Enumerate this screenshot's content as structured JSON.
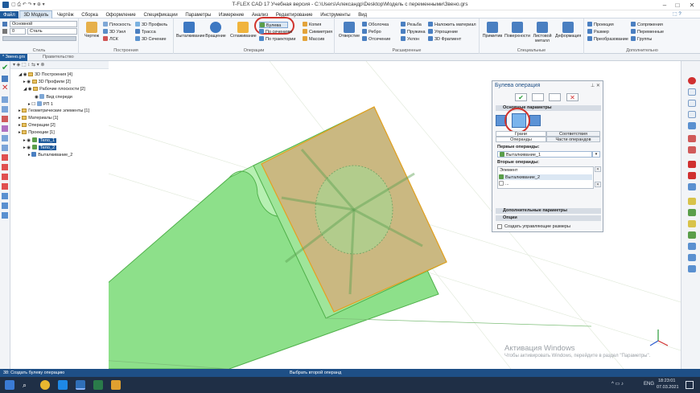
{
  "window": {
    "title": "T-FLEX CAD 17 Учебная версия - C:\\Users\\Александр\\Desktop\\Модель с переменными\\Звено.grs"
  },
  "menu": [
    "Файл",
    "3D Модель",
    "Чертёж",
    "Сборка",
    "Оформление",
    "Спецификации",
    "Параметры",
    "Измерение",
    "Анализ",
    "Редактирование",
    "Инструменты",
    "Вид"
  ],
  "ribbon": {
    "style_group": {
      "label": "Стиль",
      "layer_value": "Основной",
      "thickness_value": "0",
      "material_value": "Сталь"
    },
    "build_group": {
      "label": "Построения",
      "items": [
        "Чертеж",
        "Плоскость",
        "3D Узел",
        "ЛСК",
        "3D Профиль",
        "Трасса",
        "3D Сечение"
      ]
    },
    "ops_group": {
      "label": "Операции",
      "items": [
        "Выталкивание",
        "Вращение",
        "Сглаживание",
        "Булева",
        "По сечениям",
        "По траектории",
        "Копия",
        "Симметрия",
        "Массив"
      ]
    },
    "ext_group": {
      "label": "Расширенные",
      "items": [
        "Отверстие",
        "Оболочка",
        "Ребро",
        "Отсечение",
        "Резьба",
        "Пружина",
        "Уклон",
        "Наложить материал",
        "Упрощение",
        "3D Фрагмент"
      ]
    },
    "special_group": {
      "label": "Специальные",
      "items": [
        "Примитив",
        "Поверхности",
        "Листовой металл",
        "Деформация"
      ]
    },
    "extra_group": {
      "label": "Дополнительно",
      "items": [
        "Проекция",
        "Размер",
        "Преобразование",
        "Сопряжения",
        "Переменные",
        "Группы"
      ]
    }
  },
  "doctabs": [
    "* Звено.grs",
    "Правительство"
  ],
  "tree": [
    "3D Построения [4]",
    "3D Профили [2]",
    "Рабочие плоскости [2]",
    "Вид спереди",
    "РП 1",
    "Геометрические элементы [1]",
    "Материалы [1]",
    "Операции [2]",
    "Проекции [1]",
    "Тело_1",
    "Тело_2",
    "Выталкивание_2"
  ],
  "bool_panel": {
    "title": "Булева операция",
    "section_main": "Основные параметры",
    "tab_faces": "Грани",
    "tab_ops": "Операнды",
    "tab_match": "Соответствия",
    "tab_parts": "Части операндов",
    "first_label": "Первые операнды:",
    "first_value": "Выталкивание_1",
    "second_label": "Вторые операнды:",
    "list_header": "Элемент",
    "list_item1": "Выталкивание_2",
    "list_item2": "...",
    "section_extra": "Дополнительные параметры",
    "section_options": "Опции",
    "checkbox_label": "Создать управляющие размеры"
  },
  "status": {
    "left": "38: Создать булеву операцию",
    "center": "Выбрать второй операнд"
  },
  "watermark": {
    "line1": "Активация Windows",
    "line2": "Чтобы активировать Windows, перейдите в раздел \"Параметры\"."
  },
  "taskbar": {
    "lang": "ENG",
    "time": "18:23:01",
    "date": "07.03.2021"
  },
  "colors": {
    "accent": "#1e5a9b",
    "highlight_circle": "#d0332d",
    "solid_green": "#8de08a",
    "intersect": "#d8a878"
  }
}
